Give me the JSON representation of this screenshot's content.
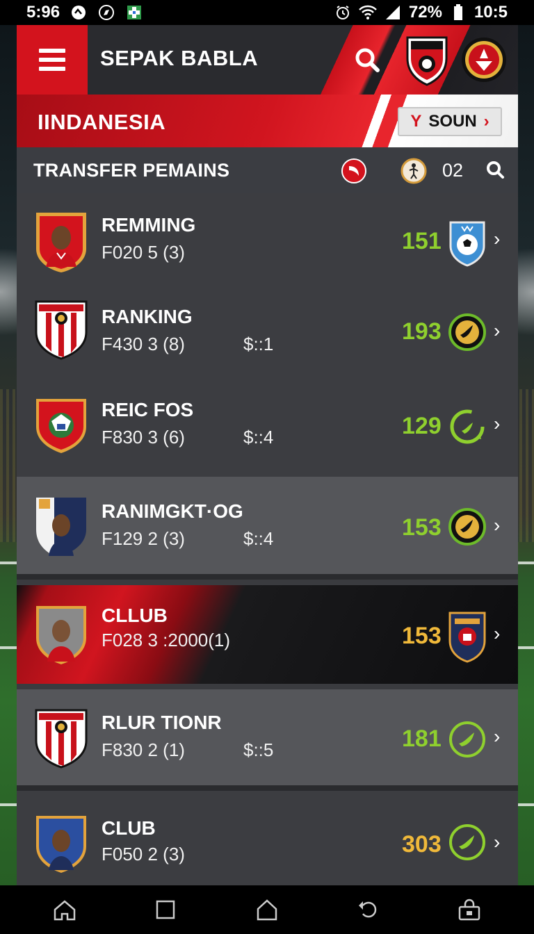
{
  "status_bar": {
    "time": "5:96",
    "battery_percent": "72%",
    "clock_right": "10:5",
    "icons": [
      "alarm-clock-icon",
      "wifi-icon",
      "cell-signal-icon",
      "battery-icon"
    ]
  },
  "header": {
    "title": "SEPAK BABLA",
    "menu_icon": "hamburger-menu-icon",
    "search_icon": "search-icon",
    "badge_1_icon": "red-shield-crest-icon",
    "badge_2_icon": "round-red-crest-icon"
  },
  "country_bar": {
    "country": "IINDANESIA",
    "button_label": "SOUN",
    "button_prefix": "Y"
  },
  "section": {
    "title": "TRANSFER PEMAINS",
    "count": "02",
    "icons": [
      "red-club-icon",
      "ball-player-icon",
      "search-icon"
    ]
  },
  "rows": [
    {
      "name": "REMMING",
      "sub": "F020 5 (3)",
      "extra": "",
      "score": "151",
      "score_color": "#8fd02e",
      "crest": "player-portrait-shield",
      "emblem": "soccer-ball-shield-icon"
    },
    {
      "name": "RANKING",
      "sub": "F430 3 (8)",
      "extra": "$::1",
      "score": "193",
      "score_color": "#8fd02e",
      "crest": "striped-club-crest",
      "emblem": "green-ring-swirl-icon"
    },
    {
      "name": "REIC FOS",
      "sub": "F830 3 (6)",
      "extra": "$::4",
      "score": "129",
      "score_color": "#8fd02e",
      "crest": "red-eagle-crest",
      "emblem": "green-swirl-arrow-icon"
    },
    {
      "name": "RANIMGKT·OG",
      "sub": "F129 2 (3)",
      "extra": "$::4",
      "score": "153",
      "score_color": "#8fd02e",
      "crest": "player-portrait-navy-shield",
      "emblem": "green-ring-swirl-icon"
    },
    {
      "name": "CLLUB",
      "sub": "F028 3 :2000(1)",
      "extra": "",
      "score": "153",
      "score_color": "#f0b93a",
      "crest": "player-portrait-gold-shield",
      "emblem": "navy-club-shield-icon"
    },
    {
      "name": "RLUR TIONR",
      "sub": "F830 2 (1)",
      "extra": "$::5",
      "score": "181",
      "score_color": "#8fd02e",
      "crest": "striped-club-crest",
      "emblem": "green-swirl-icon"
    },
    {
      "name": "CLUB",
      "sub": "F050 2 (3)",
      "extra": "",
      "score": "303",
      "score_color": "#f0b93a",
      "crest": "player-portrait-blue-shield",
      "emblem": "green-swirl-icon"
    }
  ],
  "bottom_nav": [
    "home-icon",
    "square-icon",
    "house-outline-icon",
    "back-arrow-icon",
    "toolbox-icon"
  ]
}
